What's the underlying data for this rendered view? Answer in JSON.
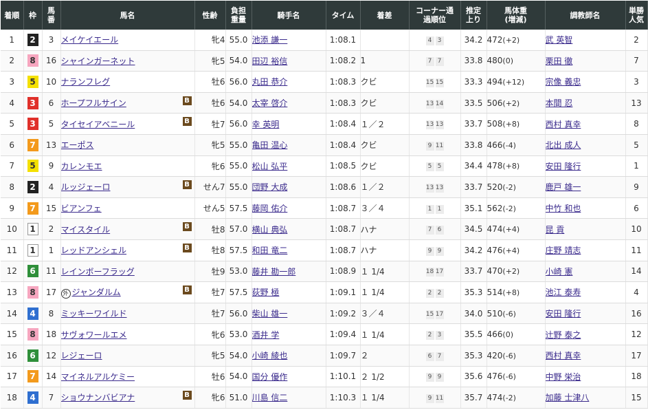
{
  "headers": {
    "rank": "着順",
    "waku": "枠",
    "umaban": "馬番",
    "name": "馬名",
    "sexage": "性齢",
    "weight": "負担重量",
    "jockey": "騎手名",
    "time": "タイム",
    "margin": "着差",
    "corner": "コーナー通過順位",
    "last3f": "推定上り",
    "bodyweight": "馬体重(増減)",
    "trainer": "調教師名",
    "popularity": "単勝人気"
  },
  "waku_colors": {
    "1": {
      "bg": "#ffffff",
      "fg": "#333333",
      "border": "#999999"
    },
    "2": {
      "bg": "#222222",
      "fg": "#ffffff",
      "border": "#222222"
    },
    "3": {
      "bg": "#e0302a",
      "fg": "#ffffff",
      "border": "#e0302a"
    },
    "4": {
      "bg": "#2f6fd0",
      "fg": "#ffffff",
      "border": "#2f6fd0"
    },
    "5": {
      "bg": "#f4e000",
      "fg": "#333333",
      "border": "#f4e000"
    },
    "6": {
      "bg": "#2f8f3a",
      "fg": "#ffffff",
      "border": "#2f8f3a"
    },
    "7": {
      "bg": "#f39a1c",
      "fg": "#ffffff",
      "border": "#f39a1c"
    },
    "8": {
      "bg": "#f6a6bf",
      "fg": "#333333",
      "border": "#f6a6bf"
    }
  },
  "rows": [
    {
      "rank": "1",
      "waku": "2",
      "umaban": "3",
      "name": "メイケイエール",
      "blinker": false,
      "foreign": false,
      "sexage": "牝4",
      "weight": "55.0",
      "jockey": "池添 謙一",
      "time": "1:08.1",
      "margin": "",
      "corner": [
        "4",
        "3"
      ],
      "last3f": "34.2",
      "bodyweight": "472",
      "bwdiff": "(+2)",
      "trainer": "武 英智",
      "popularity": "2"
    },
    {
      "rank": "2",
      "waku": "8",
      "umaban": "16",
      "name": "シャインガーネット",
      "blinker": false,
      "foreign": false,
      "sexage": "牝5",
      "weight": "54.0",
      "jockey": "田辺 裕信",
      "time": "1:08.2",
      "margin": "1",
      "corner": [
        "7",
        "7"
      ],
      "last3f": "33.8",
      "bodyweight": "480",
      "bwdiff": "(0)",
      "trainer": "栗田 徹",
      "popularity": "7"
    },
    {
      "rank": "3",
      "waku": "5",
      "umaban": "10",
      "name": "ナランフレグ",
      "blinker": false,
      "foreign": false,
      "sexage": "牡6",
      "weight": "56.0",
      "jockey": "丸田 恭介",
      "time": "1:08.3",
      "margin": "クビ",
      "corner": [
        "15",
        "15"
      ],
      "last3f": "33.3",
      "bodyweight": "494",
      "bwdiff": "(+12)",
      "trainer": "宗像 義忠",
      "popularity": "3"
    },
    {
      "rank": "4",
      "waku": "3",
      "umaban": "6",
      "name": "ホープフルサイン",
      "blinker": true,
      "foreign": false,
      "sexage": "牡6",
      "weight": "54.0",
      "jockey": "太宰 啓介",
      "time": "1:08.3",
      "margin": "クビ",
      "corner": [
        "13",
        "14"
      ],
      "last3f": "33.5",
      "bodyweight": "506",
      "bwdiff": "(+2)",
      "trainer": "本間 忍",
      "popularity": "13"
    },
    {
      "rank": "5",
      "waku": "3",
      "umaban": "5",
      "name": "タイセイアベニール",
      "blinker": true,
      "foreign": false,
      "sexage": "牡7",
      "weight": "56.0",
      "jockey": "幸 英明",
      "time": "1:08.4",
      "margin": "１／２",
      "corner": [
        "13",
        "13"
      ],
      "last3f": "33.7",
      "bodyweight": "508",
      "bwdiff": "(+8)",
      "trainer": "西村 真幸",
      "popularity": "8"
    },
    {
      "rank": "6",
      "waku": "7",
      "umaban": "13",
      "name": "エーポス",
      "blinker": false,
      "foreign": false,
      "sexage": "牝5",
      "weight": "55.0",
      "jockey": "亀田 温心",
      "time": "1:08.4",
      "margin": "クビ",
      "corner": [
        "9",
        "11"
      ],
      "last3f": "33.8",
      "bodyweight": "466",
      "bwdiff": "(-4)",
      "trainer": "北出 成人",
      "popularity": "5"
    },
    {
      "rank": "7",
      "waku": "5",
      "umaban": "9",
      "name": "カレンモエ",
      "blinker": false,
      "foreign": false,
      "sexage": "牝6",
      "weight": "55.0",
      "jockey": "松山 弘平",
      "time": "1:08.5",
      "margin": "クビ",
      "corner": [
        "5",
        "5"
      ],
      "last3f": "34.4",
      "bodyweight": "478",
      "bwdiff": "(+8)",
      "trainer": "安田 隆行",
      "popularity": "1"
    },
    {
      "rank": "8",
      "waku": "2",
      "umaban": "4",
      "name": "ルッジェーロ",
      "blinker": true,
      "foreign": false,
      "sexage": "せん7",
      "weight": "55.0",
      "jockey": "団野 大成",
      "time": "1:08.6",
      "margin": "１／２",
      "corner": [
        "13",
        "13"
      ],
      "last3f": "33.7",
      "bodyweight": "520",
      "bwdiff": "(-2)",
      "trainer": "鹿戸 雄一",
      "popularity": "9"
    },
    {
      "rank": "9",
      "waku": "7",
      "umaban": "15",
      "name": "ビアンフェ",
      "blinker": false,
      "foreign": false,
      "sexage": "せん5",
      "weight": "57.5",
      "jockey": "藤岡 佑介",
      "time": "1:08.7",
      "margin": "３／４",
      "corner": [
        "1",
        "1"
      ],
      "last3f": "35.1",
      "bodyweight": "562",
      "bwdiff": "(-2)",
      "trainer": "中竹 和也",
      "popularity": "6"
    },
    {
      "rank": "10",
      "waku": "1",
      "umaban": "2",
      "name": "マイスタイル",
      "blinker": true,
      "foreign": false,
      "sexage": "牡8",
      "weight": "57.0",
      "jockey": "横山 典弘",
      "time": "1:08.7",
      "margin": "ハナ",
      "corner": [
        "7",
        "6"
      ],
      "last3f": "34.5",
      "bodyweight": "474",
      "bwdiff": "(+4)",
      "trainer": "昆 貢",
      "popularity": "10"
    },
    {
      "rank": "11",
      "waku": "1",
      "umaban": "1",
      "name": "レッドアンシェル",
      "blinker": true,
      "foreign": false,
      "sexage": "牡8",
      "weight": "57.5",
      "jockey": "和田 竜二",
      "time": "1:08.7",
      "margin": "ハナ",
      "corner": [
        "9",
        "9"
      ],
      "last3f": "34.2",
      "bodyweight": "476",
      "bwdiff": "(+4)",
      "trainer": "庄野 靖志",
      "popularity": "11"
    },
    {
      "rank": "12",
      "waku": "6",
      "umaban": "11",
      "name": "レインボーフラッグ",
      "blinker": false,
      "foreign": false,
      "sexage": "牡9",
      "weight": "53.0",
      "jockey": "藤井 勘一郎",
      "time": "1:08.9",
      "margin": "１ 1/4",
      "corner": [
        "18",
        "17"
      ],
      "last3f": "33.7",
      "bodyweight": "470",
      "bwdiff": "(+2)",
      "trainer": "小崎 憲",
      "popularity": "14"
    },
    {
      "rank": "13",
      "waku": "8",
      "umaban": "17",
      "name": "ジャンダルム",
      "blinker": true,
      "foreign": true,
      "sexage": "牡7",
      "weight": "57.5",
      "jockey": "荻野 極",
      "time": "1:09.1",
      "margin": "１ 1/4",
      "corner": [
        "2",
        "2"
      ],
      "last3f": "35.3",
      "bodyweight": "514",
      "bwdiff": "(+8)",
      "trainer": "池江 泰寿",
      "popularity": "4"
    },
    {
      "rank": "14",
      "waku": "4",
      "umaban": "8",
      "name": "ミッキーワイルド",
      "blinker": false,
      "foreign": false,
      "sexage": "牡7",
      "weight": "56.0",
      "jockey": "柴山 雄一",
      "time": "1:09.2",
      "margin": "３／４",
      "corner": [
        "15",
        "17"
      ],
      "last3f": "34.0",
      "bodyweight": "510",
      "bwdiff": "(-6)",
      "trainer": "安田 隆行",
      "popularity": "16"
    },
    {
      "rank": "15",
      "waku": "8",
      "umaban": "18",
      "name": "サヴォワールエメ",
      "blinker": false,
      "foreign": false,
      "sexage": "牝6",
      "weight": "53.0",
      "jockey": "酒井 学",
      "time": "1:09.4",
      "margin": "１ 1/4",
      "corner": [
        "2",
        "3"
      ],
      "last3f": "35.5",
      "bodyweight": "466",
      "bwdiff": "(0)",
      "trainer": "辻野 泰之",
      "popularity": "12"
    },
    {
      "rank": "16",
      "waku": "6",
      "umaban": "12",
      "name": "レジェーロ",
      "blinker": false,
      "foreign": false,
      "sexage": "牝5",
      "weight": "54.0",
      "jockey": "小崎 綾也",
      "time": "1:09.7",
      "margin": "２",
      "corner": [
        "6",
        "7"
      ],
      "last3f": "35.3",
      "bodyweight": "420",
      "bwdiff": "(-6)",
      "trainer": "西村 真幸",
      "popularity": "17"
    },
    {
      "rank": "17",
      "waku": "7",
      "umaban": "14",
      "name": "マイネルアルケミー",
      "blinker": false,
      "foreign": false,
      "sexage": "牡6",
      "weight": "54.0",
      "jockey": "国分 優作",
      "time": "1:10.1",
      "margin": "２ 1/2",
      "corner": [
        "9",
        "9"
      ],
      "last3f": "35.6",
      "bodyweight": "476",
      "bwdiff": "(-6)",
      "trainer": "中野 栄治",
      "popularity": "18"
    },
    {
      "rank": "18",
      "waku": "4",
      "umaban": "7",
      "name": "ショウナンバビアナ",
      "blinker": true,
      "foreign": false,
      "sexage": "牝6",
      "weight": "51.0",
      "jockey": "川島 信二",
      "time": "1:10.3",
      "margin": "１ 1/4",
      "corner": [
        "9",
        "11"
      ],
      "last3f": "35.7",
      "bodyweight": "474",
      "bwdiff": "(-2)",
      "trainer": "加藤 士津八",
      "popularity": "15"
    }
  ],
  "labels": {
    "blinker": "B",
    "foreign": "外"
  }
}
